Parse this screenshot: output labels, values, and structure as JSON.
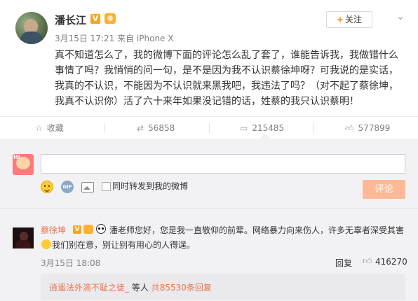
{
  "post": {
    "author": "潘长江",
    "meta": "3月15日 17:21 来自 iPhone X",
    "follow_label": "关注",
    "content": "真不知道怎么了，我的微博下面的评论怎么乱了套了，谁能告诉我，我做错什么事情了吗？我悄悄的问一句，是不是因为我不认识蔡徐坤呀？可我说的是实话，我真的不认识，不能因为不认识就来黑我吧，我违法了吗？（对不起了蔡徐坤，我真不认识你）活了六十来年如果没记错的话，姓蔡的我只认识蔡明！"
  },
  "actions": {
    "favorite_label": "收藏",
    "reposts": "56858",
    "comments": "215485",
    "likes": "577899"
  },
  "composer": {
    "repost_checkbox_label": "同时转发到我的微博",
    "submit_label": "评论"
  },
  "comment": {
    "author": "蔡徐坤",
    "text_part1": "潘老师您好，您是我一直敬仰的前辈。网络暴力向来伤人，许多无辜者深受其害",
    "text_part2": "我们别在意，别让别有用心的人得逞。",
    "date": "3月15日 18:08",
    "reply_label": "回复",
    "likes": "416270",
    "subreply": {
      "user": "逍遥法外滴不耻之徒_",
      "middle": "等人",
      "count_text": "共85530条回复"
    }
  }
}
